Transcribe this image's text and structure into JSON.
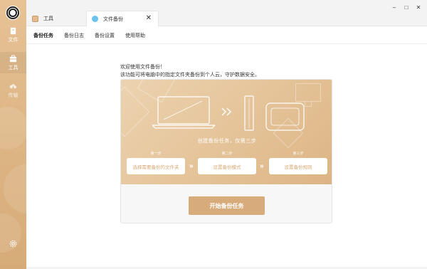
{
  "sidebar": {
    "items": [
      {
        "label": "文件",
        "icon": "file-icon"
      },
      {
        "label": "工具",
        "icon": "toolbox-icon",
        "active": true
      },
      {
        "label": "传输",
        "icon": "cloud-transfer-icon"
      }
    ],
    "settings_icon": "gear-icon",
    "colors": {
      "bg": "#dcb382",
      "text": "#ffffff"
    }
  },
  "tabs": [
    {
      "label": "工具",
      "icon": "toolbox-tab-icon"
    },
    {
      "label": "文件备份",
      "icon": "backup-tab-icon",
      "active": true,
      "close": "✕"
    }
  ],
  "window_controls": {
    "minimize": "–",
    "maximize": "□",
    "close": "✕"
  },
  "subnav": [
    {
      "label": "备份任务",
      "active": true
    },
    {
      "label": "备份日志"
    },
    {
      "label": "备份设置"
    },
    {
      "label": "使用帮助"
    }
  ],
  "main": {
    "welcome": "欢迎使用文件备份！",
    "description": "该功能可将电脑中的指定文件夹备份到个人云，守护数据安全。",
    "steps_title": "创建备份任务，仅需三步",
    "steps": [
      {
        "step": "第一步",
        "label": "选择需要备份的文件夹"
      },
      {
        "step": "第二步",
        "label": "设置备份模式"
      },
      {
        "step": "第三步",
        "label": "设置备份规则"
      }
    ],
    "start_button": "开始备份任务",
    "accent": "#d8ab7b"
  }
}
